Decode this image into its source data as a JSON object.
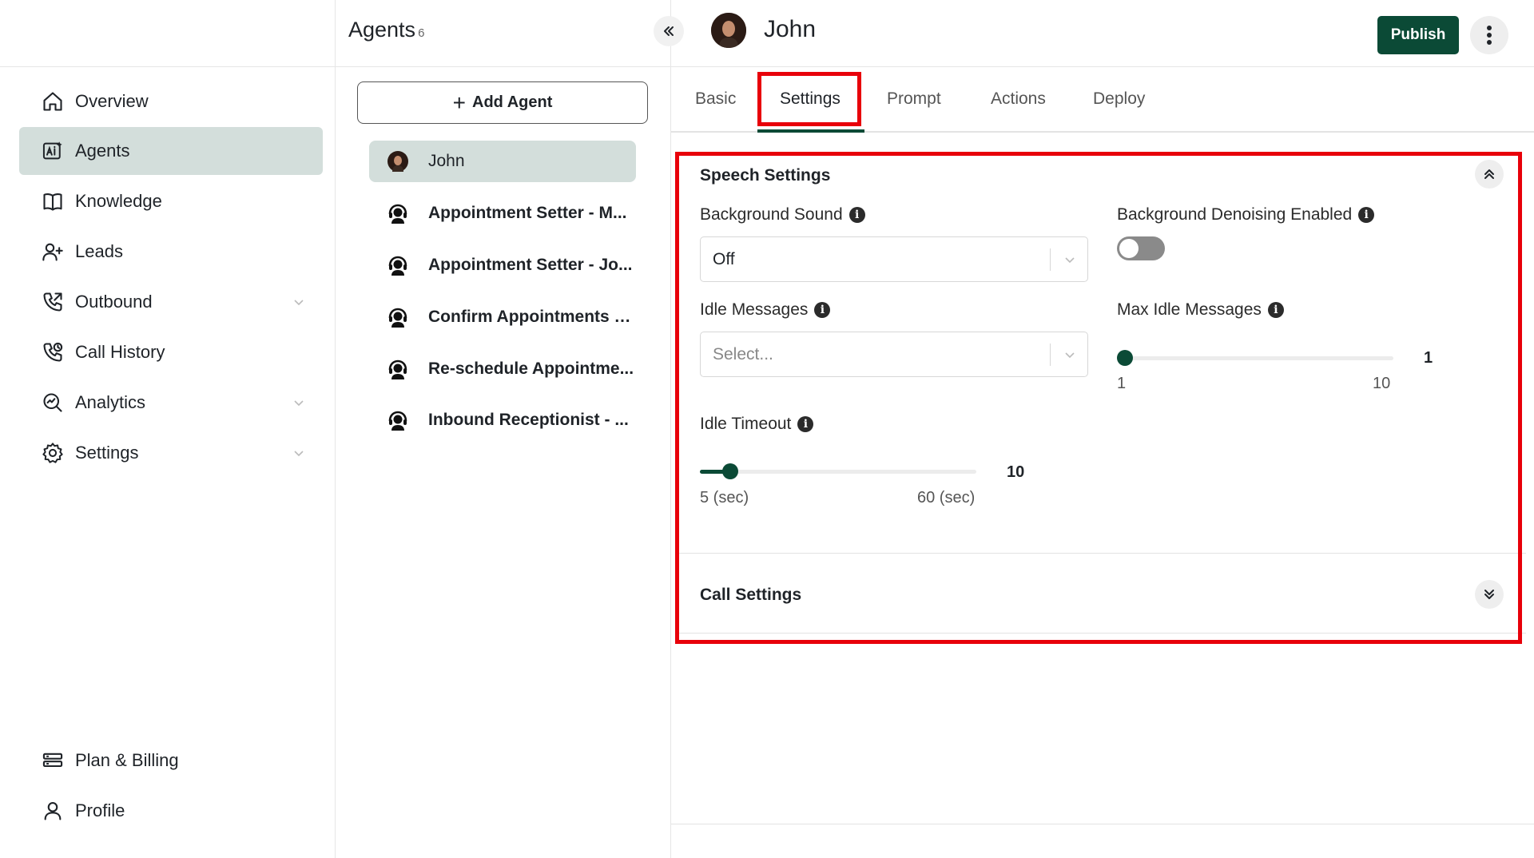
{
  "nav": {
    "items": [
      {
        "label": "Overview",
        "icon": "home-icon"
      },
      {
        "label": "Agents",
        "icon": "ai-agent-icon"
      },
      {
        "label": "Knowledge",
        "icon": "book-icon"
      },
      {
        "label": "Leads",
        "icon": "user-plus-icon"
      },
      {
        "label": "Outbound",
        "icon": "phone-outgoing-icon"
      },
      {
        "label": "Call History",
        "icon": "phone-history-icon"
      },
      {
        "label": "Analytics",
        "icon": "analytics-icon"
      },
      {
        "label": "Settings",
        "icon": "gear-icon"
      }
    ],
    "bottom": [
      {
        "label": "Plan & Billing",
        "icon": "billing-icon"
      },
      {
        "label": "Profile",
        "icon": "user-icon"
      }
    ]
  },
  "agents": {
    "title": "Agents",
    "count": "6",
    "add_label": "Add Agent",
    "list": [
      {
        "name": "John"
      },
      {
        "name": "Appointment Setter - M..."
      },
      {
        "name": "Appointment Setter - Jo..."
      },
      {
        "name": "Confirm Appointments - ..."
      },
      {
        "name": "Re-schedule Appointme..."
      },
      {
        "name": "Inbound Receptionist - ..."
      }
    ]
  },
  "header": {
    "agent_name": "John",
    "publish_label": "Publish"
  },
  "tabs": [
    "Basic",
    "Settings",
    "Prompt",
    "Actions",
    "Deploy"
  ],
  "speech": {
    "title": "Speech Settings",
    "bg_sound_label": "Background Sound",
    "bg_sound_value": "Off",
    "denoise_label": "Background Denoising Enabled",
    "denoise_enabled": false,
    "idle_msgs_label": "Idle Messages",
    "idle_msgs_placeholder": "Select...",
    "max_idle_label": "Max Idle Messages",
    "max_idle": {
      "value": "1",
      "min": "1",
      "max": "10"
    },
    "idle_timeout_label": "Idle Timeout",
    "idle_timeout": {
      "value": "10",
      "min": "5 (sec)",
      "max": "60 (sec)"
    }
  },
  "call": {
    "title": "Call Settings"
  },
  "colors": {
    "accent": "#0b4a36",
    "active_bg": "#d3dedb",
    "highlight": "#e8000a"
  }
}
